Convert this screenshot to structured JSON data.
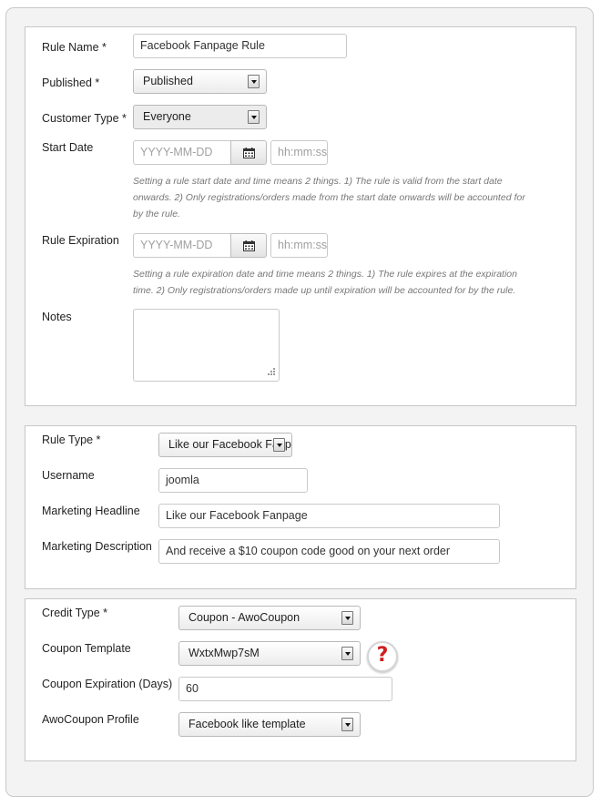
{
  "rule_section": {
    "rule_name": {
      "label": "Rule Name *",
      "value": "Facebook Fanpage Rule"
    },
    "published": {
      "label": "Published *",
      "value": "Published"
    },
    "customer_type": {
      "label": "Customer Type *",
      "value": "Everyone"
    },
    "start_date": {
      "label": "Start Date",
      "date_placeholder": "YYYY-MM-DD",
      "time_placeholder": "hh:mm:ss",
      "help_line1": "Setting a rule start date and time means 2 things. 1) The rule is valid from the start date",
      "help_line2": "onwards. 2) Only registrations/orders made from the start date onwards will be accounted for",
      "help_line3": "by the rule."
    },
    "rule_expiration": {
      "label": "Rule Expiration",
      "date_placeholder": "YYYY-MM-DD",
      "time_placeholder": "hh:mm:ss",
      "help_line1": "Setting a rule expiration date and time means 2 things. 1) The rule expires at the expiration",
      "help_line2": "time. 2) Only registrations/orders made up until expiration will be accounted for by the rule."
    },
    "notes": {
      "label": "Notes",
      "value": ""
    }
  },
  "facebook_section": {
    "rule_type": {
      "label": "Rule Type *",
      "value": "Like our Facebook Fanpage"
    },
    "username": {
      "label": "Username",
      "value": "joomla"
    },
    "marketing_headline": {
      "label": "Marketing Headline",
      "value": "Like our Facebook Fanpage"
    },
    "marketing_description": {
      "label": "Marketing Description",
      "value": "And receive a $10 coupon code good on your next order"
    }
  },
  "credit_section": {
    "credit_type": {
      "label": "Credit Type *",
      "value": "Coupon - AwoCoupon"
    },
    "coupon_template": {
      "label": "Coupon Template",
      "value": "WxtxMwp7sM",
      "help_icon": "question-mark-icon",
      "help_color": "#d01f1f"
    },
    "coupon_expiration": {
      "label": "Coupon Expiration (Days)",
      "value": "60"
    },
    "awocoupon_profile": {
      "label": "AwoCoupon Profile",
      "value": "Facebook like template"
    }
  }
}
